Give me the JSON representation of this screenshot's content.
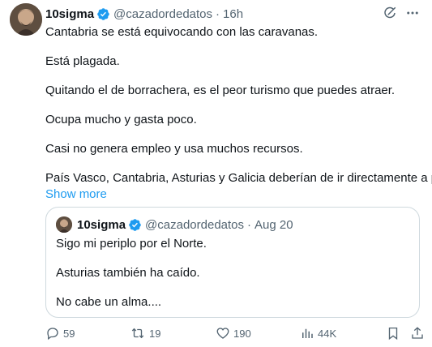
{
  "author": {
    "display_name": "10sigma",
    "handle": "@cazadordedatos",
    "time": "16h"
  },
  "tweet": {
    "paragraphs": [
      "Cantabria se está equivocando con las caravanas.",
      "Está plagada.",
      "Quitando el de borrachera, es el peor turismo que puedes atraer.",
      "Ocupa mucho y gasta poco.",
      "Casi no genera empleo y usa muchos recursos.",
      "País Vasco, Cantabria, Asturias y Galicia deberían de ir directamente a por"
    ],
    "show_more": "Show more"
  },
  "quote": {
    "display_name": "10sigma",
    "handle": "@cazadordedatos",
    "date": "Aug 20",
    "paragraphs": [
      "Sigo mi periplo por el Norte.",
      "Asturias también ha caído.",
      "No cabe un alma...."
    ]
  },
  "actions": {
    "replies": "59",
    "retweets": "19",
    "likes": "190",
    "views": "44K"
  },
  "icons": {
    "header": [
      "grok-icon",
      "more-icon"
    ],
    "actions": [
      "reply-icon",
      "retweet-icon",
      "like-icon",
      "views-icon",
      "bookmark-icon",
      "share-icon"
    ]
  },
  "colors": {
    "text": "#0f1419",
    "muted": "#536471",
    "link": "#1d9bf0",
    "verified": "#1d9bf0",
    "border": "#cfd9de"
  }
}
